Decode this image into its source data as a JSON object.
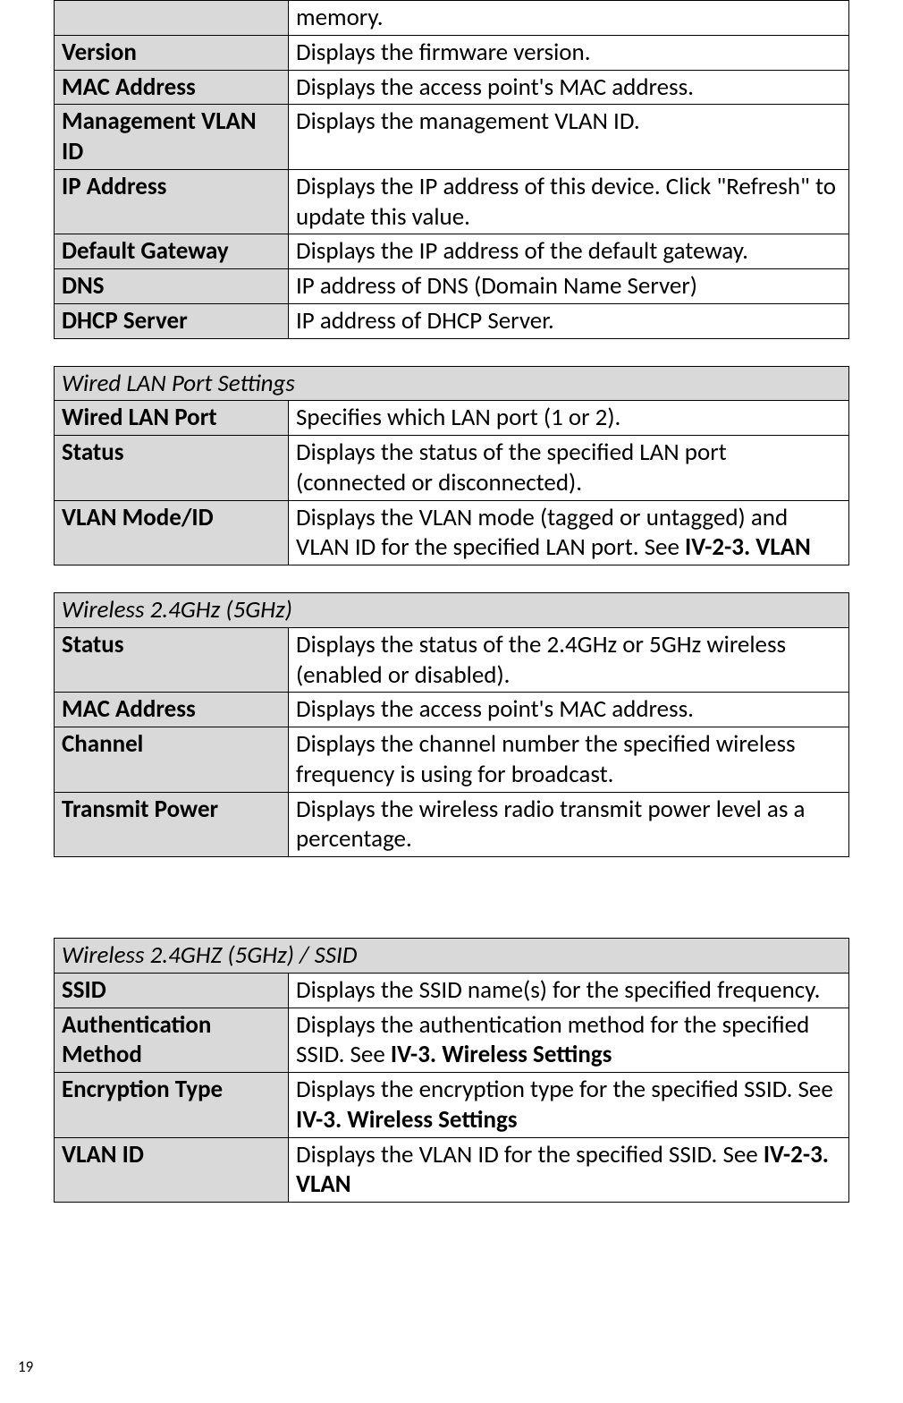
{
  "page_number": "19",
  "tables": {
    "system": {
      "rows": [
        {
          "label": "",
          "desc": "memory."
        },
        {
          "label": "Version",
          "desc": "Displays the firmware version."
        },
        {
          "label": "MAC Address",
          "desc": "Displays the access point's MAC address."
        },
        {
          "label": "Management VLAN ID",
          "desc": "Displays the management VLAN ID."
        },
        {
          "label": "IP Address",
          "desc": "Displays the IP address of this device. Click \"Refresh\" to update this value."
        },
        {
          "label": "Default Gateway",
          "desc": "Displays the IP address of the default gateway."
        },
        {
          "label": "DNS",
          "desc": "IP address of DNS (Domain Name Server)"
        },
        {
          "label": "DHCP Server",
          "desc": "IP address of DHCP Server."
        }
      ]
    },
    "wired_lan": {
      "title": "Wired LAN Port Settings",
      "rows": [
        {
          "label": "Wired LAN Port",
          "desc": "Specifies which LAN port (1 or 2)."
        },
        {
          "label": "Status",
          "desc": "Displays the status of the specified LAN port (connected or disconnected)."
        },
        {
          "label": "VLAN Mode/ID",
          "desc_pre": "Displays the VLAN mode (tagged or untagged) and VLAN ID for the specified LAN port. See ",
          "desc_bold": "IV-2-3. VLAN"
        }
      ]
    },
    "wireless": {
      "title": "Wireless 2.4GHz (5GHz)",
      "rows": [
        {
          "label": "Status",
          "desc": "Displays the status of the 2.4GHz or 5GHz wireless (enabled or disabled)."
        },
        {
          "label": "MAC Address",
          "desc": "Displays the access point's MAC address."
        },
        {
          "label": "Channel",
          "desc": "Displays the channel number the specified wireless frequency is using for broadcast."
        },
        {
          "label": "Transmit Power",
          "desc": "Displays the wireless radio transmit power level as a percentage."
        }
      ]
    },
    "ssid": {
      "title": "Wireless 2.4GHZ (5GHz) / SSID",
      "rows": [
        {
          "label": "SSID",
          "desc": "Displays the SSID name(s) for the specified frequency."
        },
        {
          "label": "Authentication Method",
          "desc_pre": "Displays the authentication method for the specified SSID. See ",
          "desc_bold": "IV-3. Wireless Settings"
        },
        {
          "label": "Encryption Type",
          "desc_pre": "Displays the encryption type for the specified SSID. See ",
          "desc_bold": "IV-3. Wireless Settings"
        },
        {
          "label": "VLAN ID",
          "desc_pre": "Displays the VLAN ID for the specified SSID. See ",
          "desc_bold": "IV-2-3. VLAN"
        }
      ]
    }
  }
}
